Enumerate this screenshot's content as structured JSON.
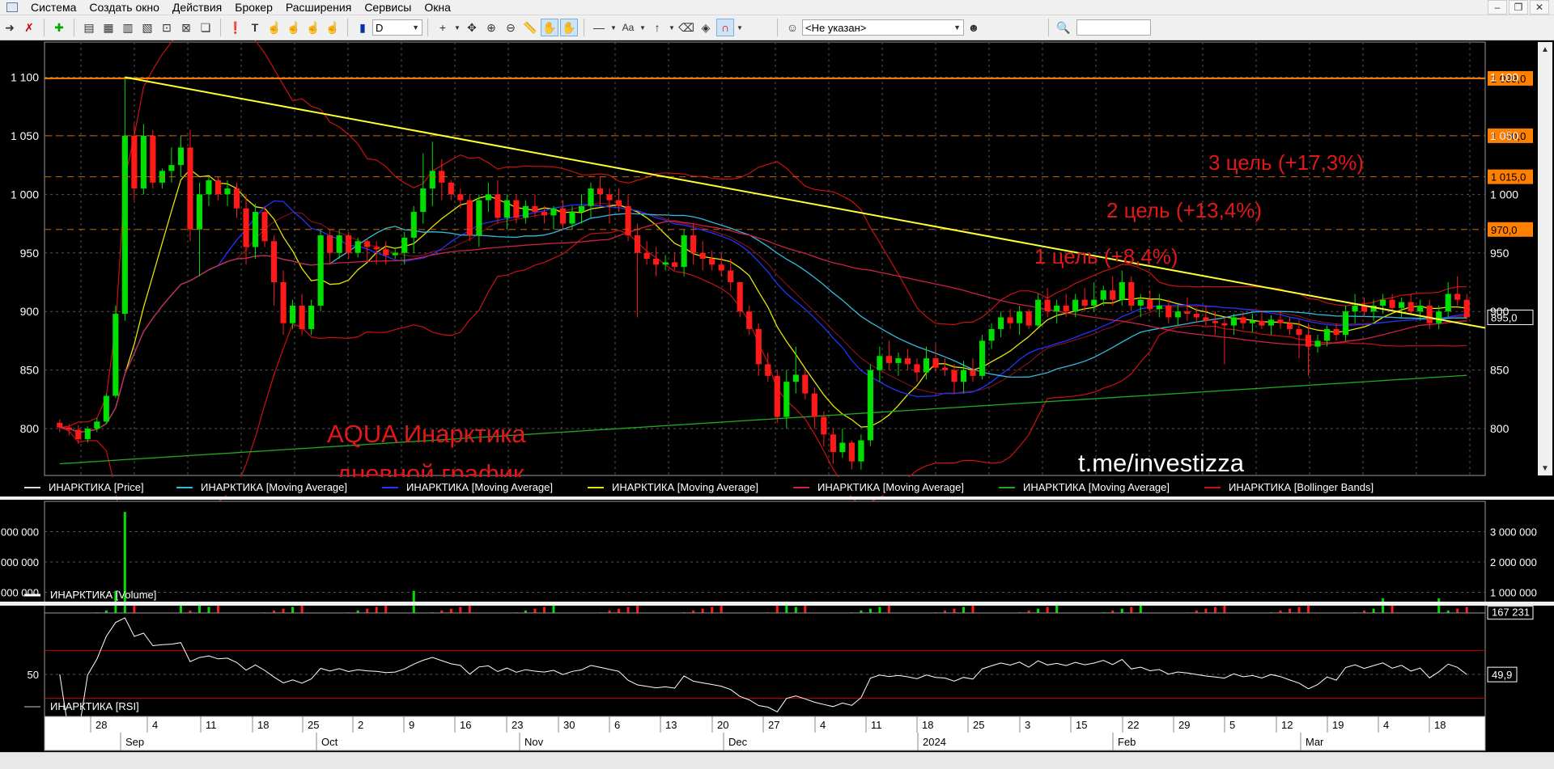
{
  "menu": {
    "items": [
      "Система",
      "Создать окно",
      "Действия",
      "Брокер",
      "Расширения",
      "Сервисы",
      "Окна"
    ]
  },
  "toolbar": {
    "period_value": "D",
    "account_value": "<Не указан>",
    "search_value": ""
  },
  "price_axis": {
    "ticks": [
      "1 100",
      "1 050",
      "1 000",
      "950",
      "900",
      "850",
      "800"
    ],
    "left_ticks": [
      "1 100",
      "1 050",
      "1 000",
      "950",
      "900",
      "850",
      "800"
    ]
  },
  "levels": {
    "top": {
      "label": "1 099,0",
      "color": "#ff8000"
    },
    "l1050": {
      "label": "1 050,0"
    },
    "l1015": {
      "label": "1 015,0"
    },
    "l970": {
      "label": "970,0"
    },
    "last": {
      "label": "895,0"
    }
  },
  "annotations": {
    "target3": "3 цель (+17,3%)",
    "target2": "2 цель (+13,4%)",
    "target1": "1 цель (+8,4%)",
    "title_line1": "AQUA  Инарктика",
    "title_line2": "дневной график",
    "channel": "t.me/investizza"
  },
  "legend": {
    "price": "ИНАРКТИКА [Price]",
    "ma1": "ИНАРКТИКА [Moving Average]",
    "ma2": "ИНАРКТИКА [Moving Average]",
    "ma3": "ИНАРКТИКА [Moving Average]",
    "ma4": "ИНАРКТИКА [Moving Average]",
    "ma5": "ИНАРКТИКА [Moving Average]",
    "bb": "ИНАРКТИКА [Bollinger Bands]"
  },
  "colors": {
    "up": "#00e000",
    "down": "#ff1a1a",
    "ma_cyan": "#33bbdd",
    "ma_blue": "#2233ff",
    "ma_yellow": "#e6e600",
    "ma_red": "#cc2244",
    "ma_green": "#22aa22",
    "bb": "#cc1111",
    "trend": "#ffff33",
    "target_text": "#e01818"
  },
  "volume": {
    "legend": "ИНАРКТИКА [Volume]",
    "ticks": [
      "3 000 000",
      "2 000 000",
      "1 000 000"
    ],
    "left_ticks": [
      "000 000",
      "000 000",
      "000 000"
    ],
    "last": "167 231"
  },
  "rsi": {
    "legend": "ИНАРКТИКА [RSI]",
    "tick": "50",
    "right_tick": "50",
    "last": "49,9"
  },
  "date_axis": {
    "days": [
      "28",
      "4",
      "11",
      "18",
      "25",
      "2",
      "9",
      "16",
      "23",
      "30",
      "6",
      "13",
      "20",
      "27",
      "4",
      "11",
      "18",
      "25",
      "3",
      "15",
      "22",
      "29",
      "5",
      "12",
      "19",
      "4",
      "18"
    ],
    "months": [
      "Sep",
      "Oct",
      "Nov",
      "Dec",
      "2024",
      "Feb",
      "Mar"
    ]
  },
  "chart_data": {
    "type": "candlestick",
    "y_range": [
      760,
      1130
    ],
    "ohlc": [
      [
        805,
        808,
        797,
        801
      ],
      [
        801,
        804,
        794,
        799
      ],
      [
        799,
        803,
        787,
        791
      ],
      [
        791,
        802,
        788,
        800
      ],
      [
        800,
        809,
        797,
        806
      ],
      [
        806,
        830,
        804,
        828
      ],
      [
        828,
        905,
        826,
        898
      ],
      [
        898,
        1100,
        892,
        1050
      ],
      [
        1050,
        1060,
        995,
        1005
      ],
      [
        1005,
        1060,
        1000,
        1050
      ],
      [
        1050,
        1055,
        1005,
        1010
      ],
      [
        1010,
        1022,
        1005,
        1020
      ],
      [
        1020,
        1040,
        1010,
        1025
      ],
      [
        1025,
        1050,
        1015,
        1040
      ],
      [
        1040,
        1055,
        960,
        970
      ],
      [
        970,
        1010,
        930,
        1000
      ],
      [
        1000,
        1015,
        990,
        1012
      ],
      [
        1012,
        1015,
        995,
        1000
      ],
      [
        1000,
        1012,
        990,
        1005
      ],
      [
        1005,
        1010,
        980,
        988
      ],
      [
        988,
        1000,
        940,
        955
      ],
      [
        955,
        992,
        945,
        985
      ],
      [
        985,
        990,
        955,
        960
      ],
      [
        960,
        965,
        905,
        925
      ],
      [
        925,
        935,
        880,
        890
      ],
      [
        890,
        910,
        885,
        905
      ],
      [
        905,
        915,
        880,
        885
      ],
      [
        885,
        910,
        880,
        905
      ],
      [
        905,
        970,
        900,
        965
      ],
      [
        965,
        970,
        940,
        950
      ],
      [
        950,
        970,
        945,
        965
      ],
      [
        965,
        968,
        945,
        950
      ],
      [
        950,
        963,
        946,
        960
      ],
      [
        960,
        962,
        943,
        955
      ],
      [
        955,
        960,
        940,
        953
      ],
      [
        953,
        960,
        940,
        948
      ],
      [
        948,
        955,
        945,
        950
      ],
      [
        950,
        968,
        940,
        963
      ],
      [
        963,
        990,
        950,
        985
      ],
      [
        985,
        1035,
        975,
        1005
      ],
      [
        1005,
        1045,
        990,
        1020
      ],
      [
        1020,
        1030,
        995,
        1010
      ],
      [
        1010,
        1012,
        995,
        1000
      ],
      [
        1000,
        1005,
        988,
        995
      ],
      [
        995,
        1000,
        960,
        965
      ],
      [
        965,
        1000,
        955,
        995
      ],
      [
        995,
        1010,
        985,
        1000
      ],
      [
        1000,
        1012,
        975,
        980
      ],
      [
        980,
        1000,
        970,
        995
      ],
      [
        995,
        1000,
        975,
        980
      ],
      [
        980,
        995,
        975,
        990
      ],
      [
        990,
        1000,
        980,
        985
      ],
      [
        985,
        990,
        975,
        982
      ],
      [
        982,
        990,
        970,
        988
      ],
      [
        988,
        995,
        970,
        975
      ],
      [
        975,
        990,
        970,
        985
      ],
      [
        985,
        1000,
        975,
        990
      ],
      [
        990,
        1010,
        980,
        1005
      ],
      [
        1005,
        1015,
        990,
        1000
      ],
      [
        1000,
        1005,
        975,
        995
      ],
      [
        995,
        1005,
        985,
        990
      ],
      [
        990,
        1000,
        960,
        965
      ],
      [
        965,
        975,
        895,
        950
      ],
      [
        950,
        960,
        940,
        945
      ],
      [
        945,
        955,
        930,
        940
      ],
      [
        940,
        948,
        935,
        942
      ],
      [
        942,
        950,
        935,
        938
      ],
      [
        938,
        970,
        930,
        965
      ],
      [
        965,
        975,
        940,
        950
      ],
      [
        950,
        960,
        935,
        945
      ],
      [
        945,
        952,
        935,
        940
      ],
      [
        940,
        950,
        930,
        935
      ],
      [
        935,
        945,
        918,
        925
      ],
      [
        925,
        905,
        895,
        900
      ],
      [
        900,
        905,
        880,
        885
      ],
      [
        885,
        890,
        845,
        855
      ],
      [
        855,
        865,
        840,
        845
      ],
      [
        845,
        850,
        805,
        810
      ],
      [
        810,
        850,
        800,
        840
      ],
      [
        840,
        870,
        830,
        846
      ],
      [
        846,
        850,
        825,
        830
      ],
      [
        830,
        835,
        800,
        810
      ],
      [
        810,
        815,
        785,
        795
      ],
      [
        795,
        800,
        770,
        780
      ],
      [
        780,
        800,
        775,
        788
      ],
      [
        788,
        790,
        765,
        772
      ],
      [
        772,
        795,
        765,
        790
      ],
      [
        790,
        855,
        785,
        850
      ],
      [
        850,
        870,
        840,
        862
      ],
      [
        862,
        875,
        850,
        856
      ],
      [
        856,
        865,
        845,
        860
      ],
      [
        860,
        868,
        850,
        855
      ],
      [
        855,
        860,
        840,
        848
      ],
      [
        848,
        870,
        842,
        860
      ],
      [
        860,
        872,
        848,
        852
      ],
      [
        852,
        860,
        845,
        850
      ],
      [
        850,
        855,
        830,
        840
      ],
      [
        840,
        858,
        830,
        850
      ],
      [
        850,
        860,
        840,
        845
      ],
      [
        845,
        880,
        842,
        875
      ],
      [
        875,
        890,
        868,
        885
      ],
      [
        885,
        900,
        878,
        895
      ],
      [
        895,
        902,
        885,
        890
      ],
      [
        890,
        905,
        880,
        900
      ],
      [
        900,
        902,
        885,
        888
      ],
      [
        888,
        915,
        885,
        910
      ],
      [
        910,
        920,
        895,
        900
      ],
      [
        900,
        910,
        890,
        905
      ],
      [
        905,
        915,
        895,
        900
      ],
      [
        900,
        915,
        895,
        910
      ],
      [
        910,
        920,
        900,
        905
      ],
      [
        905,
        925,
        900,
        910
      ],
      [
        910,
        922,
        905,
        918
      ],
      [
        918,
        930,
        905,
        910
      ],
      [
        910,
        935,
        905,
        925
      ],
      [
        925,
        930,
        900,
        905
      ],
      [
        905,
        915,
        895,
        910
      ],
      [
        910,
        918,
        900,
        902
      ],
      [
        902,
        915,
        895,
        905
      ],
      [
        905,
        910,
        890,
        895
      ],
      [
        895,
        905,
        888,
        900
      ],
      [
        900,
        912,
        892,
        898
      ],
      [
        898,
        903,
        890,
        895
      ],
      [
        895,
        905,
        888,
        892
      ],
      [
        892,
        900,
        880,
        890
      ],
      [
        890,
        895,
        855,
        888
      ],
      [
        888,
        898,
        880,
        895
      ],
      [
        895,
        900,
        885,
        890
      ],
      [
        890,
        898,
        882,
        892
      ],
      [
        892,
        900,
        885,
        888
      ],
      [
        888,
        897,
        880,
        893
      ],
      [
        893,
        900,
        885,
        890
      ],
      [
        890,
        895,
        880,
        885
      ],
      [
        885,
        893,
        860,
        880
      ],
      [
        880,
        890,
        845,
        870
      ],
      [
        870,
        880,
        865,
        875
      ],
      [
        875,
        888,
        870,
        885
      ],
      [
        885,
        890,
        875,
        880
      ],
      [
        880,
        905,
        875,
        900
      ],
      [
        900,
        915,
        890,
        905
      ],
      [
        905,
        912,
        895,
        900
      ],
      [
        900,
        910,
        892,
        905
      ],
      [
        905,
        915,
        898,
        910
      ],
      [
        910,
        915,
        900,
        903
      ],
      [
        903,
        912,
        895,
        908
      ],
      [
        908,
        915,
        898,
        900
      ],
      [
        900,
        910,
        892,
        905
      ],
      [
        905,
        910,
        885,
        890
      ],
      [
        890,
        905,
        885,
        900
      ],
      [
        900,
        925,
        895,
        915
      ],
      [
        915,
        930,
        905,
        910
      ],
      [
        910,
        915,
        893,
        895
      ]
    ],
    "trendline": {
      "from": [
        7,
        1100
      ],
      "to": [
        170,
        886
      ]
    },
    "horizontal_levels": [
      1099,
      1050,
      1015,
      970
    ],
    "rsi_levels": [
      30,
      70
    ],
    "last_price": 895,
    "last_volume": 167231,
    "last_rsi": 49.9
  }
}
